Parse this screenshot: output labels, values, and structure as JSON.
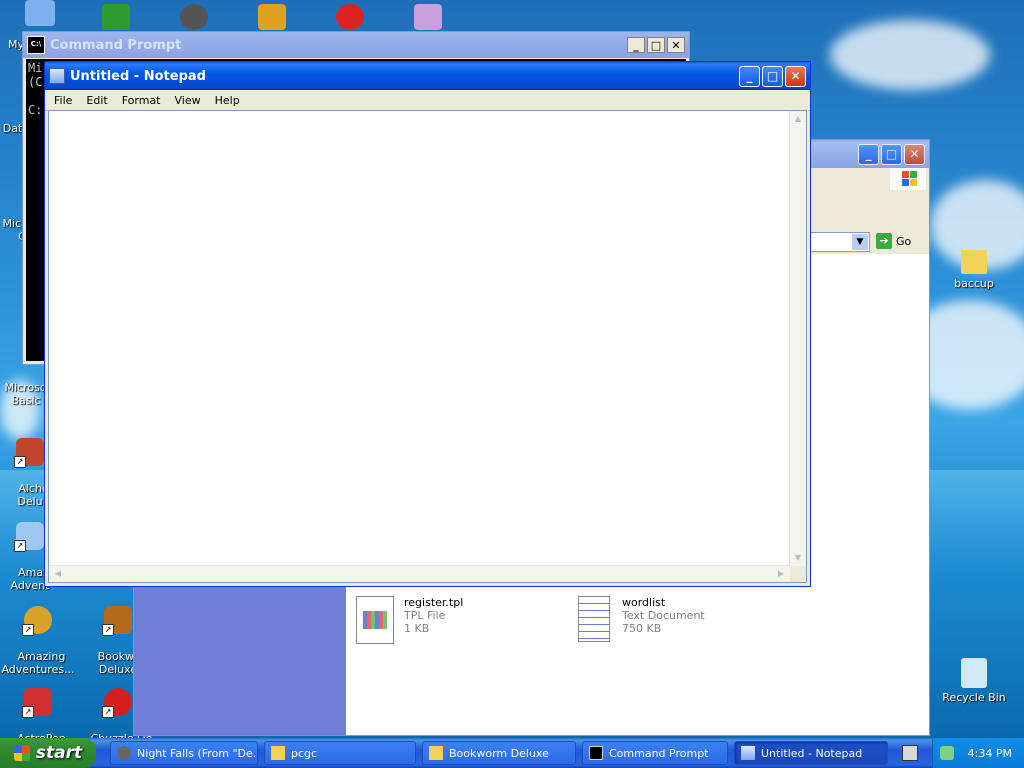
{
  "desktop": {
    "icons_left": [
      {
        "label": "My",
        "color": "#6aa6f0"
      },
      {
        "label": "Date",
        "color": "#4a8f5a"
      },
      {
        "label": "Microsof\nC",
        "color": "#3a6fc0"
      },
      {
        "label": "Microsoft\nBasic",
        "color": "#3a6fc0"
      },
      {
        "label": "Alche\nDelu",
        "color": "#c0452a"
      },
      {
        "label": "Amaz\nAdvent",
        "color": "#7fb0e0"
      },
      {
        "label": "Amazing\nAdventures...",
        "color": "#d8a32a"
      },
      {
        "label": "AstroPop\nDeluxe",
        "color": "#d23030"
      }
    ],
    "icons_col2": [
      {
        "label": "Bookwor\nDeluxe",
        "color": "#b56a1c"
      },
      {
        "label": "Chuzzle De",
        "color": "#d42020"
      }
    ],
    "icons_right": [
      {
        "label": "baccup",
        "color": "#f2d35a"
      },
      {
        "label": "Recycle Bin",
        "color": "#7fd0a0"
      }
    ]
  },
  "cmd_window": {
    "title": "Command Prompt",
    "lines": [
      "Mi",
      "(C",
      "",
      "C:"
    ]
  },
  "explorer_window": {
    "go_label": "Go",
    "files": [
      {
        "name": "register.tpl",
        "type": "TPL File",
        "size": "1 KB"
      },
      {
        "name": "wordlist",
        "type": "Text Document",
        "size": "750 KB"
      }
    ]
  },
  "notepad": {
    "title": "Untitled - Notepad",
    "menu": [
      "File",
      "Edit",
      "Format",
      "View",
      "Help"
    ],
    "content": ""
  },
  "taskbar": {
    "start_label": "start",
    "tasks": [
      {
        "label": "Night Falls (From \"De...",
        "active": false
      },
      {
        "label": "pcgc",
        "active": false
      },
      {
        "label": "Bookworm Deluxe",
        "active": false
      },
      {
        "label": "Command Prompt",
        "active": false
      },
      {
        "label": "Untitled - Notepad",
        "active": true
      }
    ],
    "clock": "4:34 PM"
  }
}
